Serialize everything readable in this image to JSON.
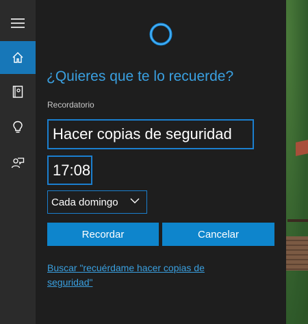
{
  "sidebar": {
    "items": [
      {
        "icon": "hamburger-menu-icon",
        "active": false
      },
      {
        "icon": "home-icon",
        "active": true
      },
      {
        "icon": "notebook-icon",
        "active": false
      },
      {
        "icon": "lightbulb-icon",
        "active": false
      },
      {
        "icon": "feedback-icon",
        "active": false
      }
    ]
  },
  "cortana": {
    "icon": "cortana-ring-icon"
  },
  "main": {
    "question": "¿Quieres que te lo recuerde?",
    "reminder_label": "Recordatorio",
    "reminder_title": "Hacer copias de seguridad",
    "time": "17:08",
    "frequency": "Cada domingo",
    "remind_button": "Recordar",
    "cancel_button": "Cancelar",
    "search_link": "Buscar \"recuérdame hacer copias de seguridad\""
  },
  "colors": {
    "accent": "#1777b8",
    "link": "#3aa0e0",
    "button": "#0e85cc",
    "panel": "#1e1e1e",
    "sidebar": "#2b2b2b"
  }
}
